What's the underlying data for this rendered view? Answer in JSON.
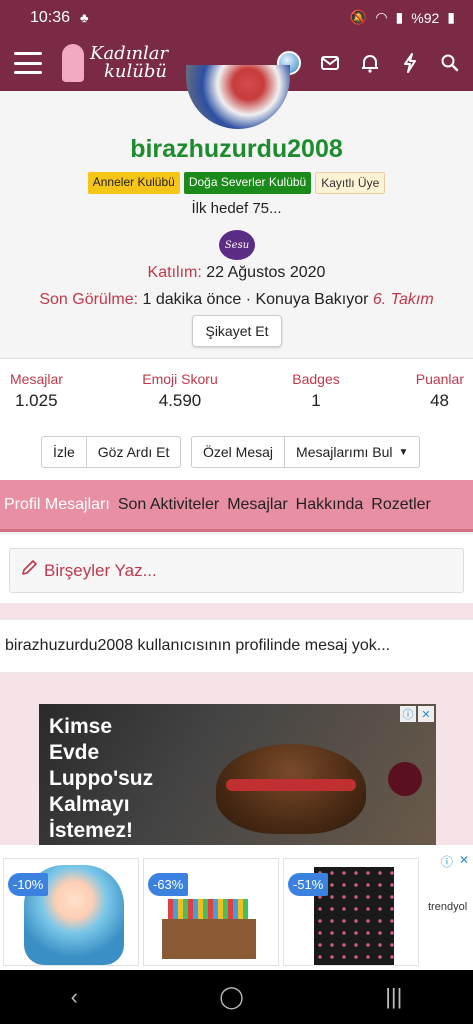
{
  "status_bar": {
    "time": "10:36",
    "battery": "%92"
  },
  "header": {
    "logo_line1": "Kadınlar",
    "logo_line2": "kulübü"
  },
  "profile": {
    "username": "birazhuzurdu2008",
    "badges": [
      "Anneler Kulübü",
      "Doğa Severler Kulübü",
      "Kayıtlı Üye"
    ],
    "status_message": "İlk hedef 75...",
    "brand_logo_text": "Sesu",
    "joined_label": "Katılım:",
    "joined_value": "22 Ağustos 2020",
    "last_seen_label": "Son Görülme:",
    "last_seen_value": "1 dakika önce · Konuya Bakıyor",
    "last_seen_topic": "6. Takım",
    "report_label": "Şikayet Et"
  },
  "stats": [
    {
      "label": "Mesajlar",
      "value": "1.025"
    },
    {
      "label": "Emoji Skoru",
      "value": "4.590"
    },
    {
      "label": "Badges",
      "value": "1"
    },
    {
      "label": "Puanlar",
      "value": "48"
    }
  ],
  "actions": {
    "group1": [
      "İzle",
      "Göz Ardı Et"
    ],
    "group2": [
      "Özel Mesaj",
      "Mesajlarımı Bul"
    ]
  },
  "tabs": [
    "Profil Mesajları",
    "Son Aktiviteler",
    "Mesajlar",
    "Hakkında",
    "Rozetler"
  ],
  "composer": {
    "placeholder": "Birşeyler Yaz..."
  },
  "empty_message": "birazhuzurdu2008 kullanıcısının profilinde mesaj yok...",
  "ad1": {
    "text_lines": [
      "Kimse",
      "Evde",
      "Luppo'suz",
      "Kalmayı",
      "İstemez!"
    ]
  },
  "ad2": {
    "products": [
      {
        "discount": "-10%"
      },
      {
        "discount": "-63%"
      },
      {
        "discount": "-51%"
      }
    ],
    "brand": "trendyol"
  },
  "colors": {
    "header_bg": "#7a2a45",
    "accent_red": "#c0394a",
    "username_green": "#1e8b2f",
    "tab_bar_pink": "#e88fa4"
  }
}
